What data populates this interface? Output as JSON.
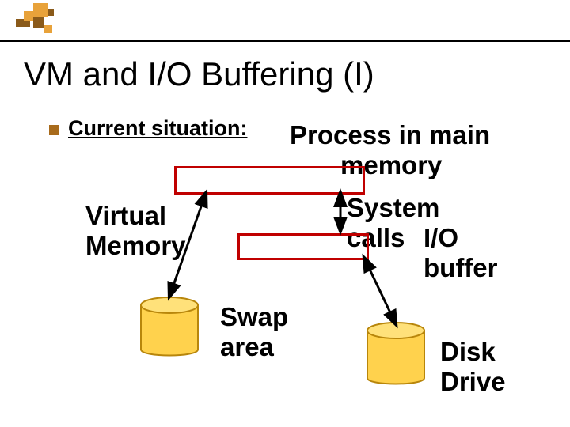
{
  "title": "VM and I/O Buffering (I)",
  "subhead": "Current situation:",
  "labels": {
    "process": "Process in main",
    "memory": "memory",
    "virtual": "Virtual",
    "memory2": "Memory",
    "system": "System",
    "calls": "calls",
    "io": "I/O",
    "buffer": "buffer",
    "swap": "Swap",
    "area": "area",
    "disk": "Disk",
    "drive": "Drive"
  }
}
